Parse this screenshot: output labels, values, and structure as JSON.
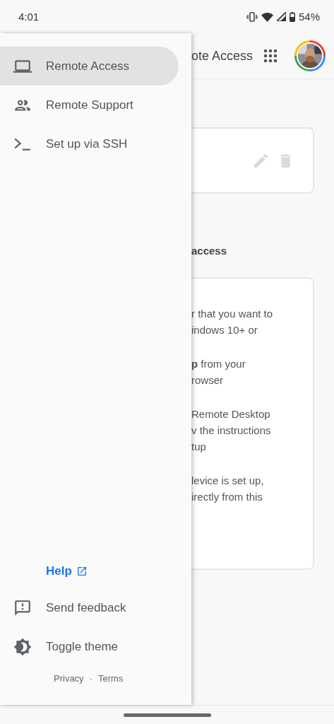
{
  "status_bar": {
    "time": "4:01",
    "battery": "54%"
  },
  "drawer": {
    "items": [
      {
        "label": "Remote Access",
        "kind": "laptop",
        "selected": true
      },
      {
        "label": "Remote Support",
        "kind": "people",
        "selected": false
      },
      {
        "label": "Set up via SSH",
        "kind": "terminal",
        "selected": false
      }
    ],
    "help": "Help",
    "footer_items": [
      {
        "label": "Send feedback",
        "kind": "feedback"
      },
      {
        "label": "Toggle theme",
        "kind": "theme"
      }
    ],
    "links": [
      "Privacy",
      "Terms"
    ],
    "separator": "·"
  },
  "page": {
    "header_title": "ote Access",
    "section_heading": "access",
    "paragraphs": [
      [
        "r that you want to",
        "indows 10+ or"
      ],
      [
        "**p** from your",
        "rowser"
      ],
      [
        "Remote Desktop",
        "v the instructions",
        "tup"
      ],
      [
        "levice is set up,",
        "irectly from this"
      ]
    ]
  }
}
